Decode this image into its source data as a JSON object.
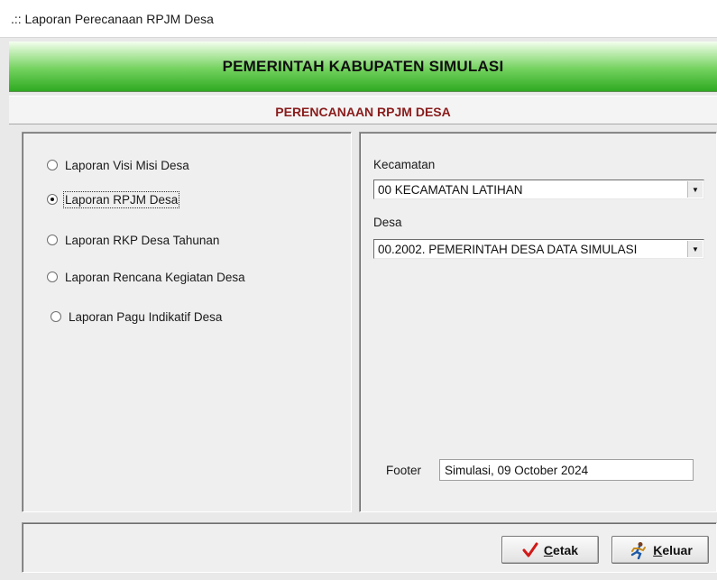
{
  "window": {
    "title": ".:: Laporan Perecanaan RPJM Desa"
  },
  "header": {
    "title": "PEMERINTAH KABUPATEN SIMULASI",
    "subtitle": "PERENCANAAN RPJM DESA"
  },
  "report_options": [
    {
      "label": "Laporan Visi Misi Desa",
      "selected": false
    },
    {
      "label": "Laporan RPJM Desa",
      "selected": true
    },
    {
      "label": "Laporan RKP Desa Tahunan",
      "selected": false
    },
    {
      "label": "Laporan Rencana Kegiatan Desa",
      "selected": false
    },
    {
      "label": "Laporan Pagu Indikatif Desa",
      "selected": false
    }
  ],
  "filters": {
    "kecamatan": {
      "label": "Kecamatan",
      "value": "00  KECAMATAN LATIHAN"
    },
    "desa": {
      "label": "Desa",
      "value": "00.2002.  PEMERINTAH DESA DATA SIMULASI"
    }
  },
  "footer": {
    "label": "Footer",
    "value": "Simulasi, 09 October 2024"
  },
  "buttons": {
    "cetak": "Cetak",
    "keluar": "Keluar"
  },
  "colors": {
    "header_green": "#2faa22",
    "subtitle_red": "#8a1c1c",
    "check_red": "#d11919"
  }
}
